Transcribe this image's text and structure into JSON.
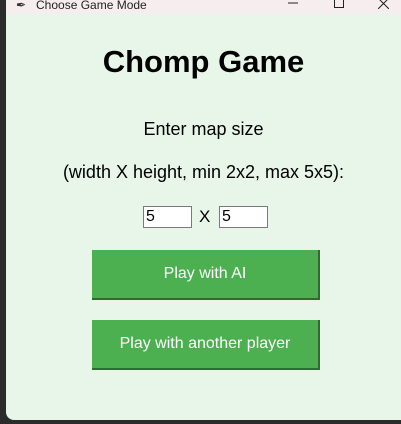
{
  "window": {
    "title": "Choose Game Mode",
    "app_icon": "feather-icon",
    "controls": [
      "minimize-icon",
      "maximize-icon",
      "close-icon"
    ]
  },
  "main": {
    "heading": "Chomp Game",
    "prompt_line1": "Enter map size",
    "prompt_line2": "(width X height, min 2x2, max 5x5):",
    "width_value": "5",
    "separator": "X",
    "height_value": "5",
    "play_ai_label": "Play with AI",
    "play_player_label": "Play with another player"
  },
  "colors": {
    "background": "#e8f5e9",
    "button": "#4caf50",
    "button_text": "#ffffff"
  }
}
